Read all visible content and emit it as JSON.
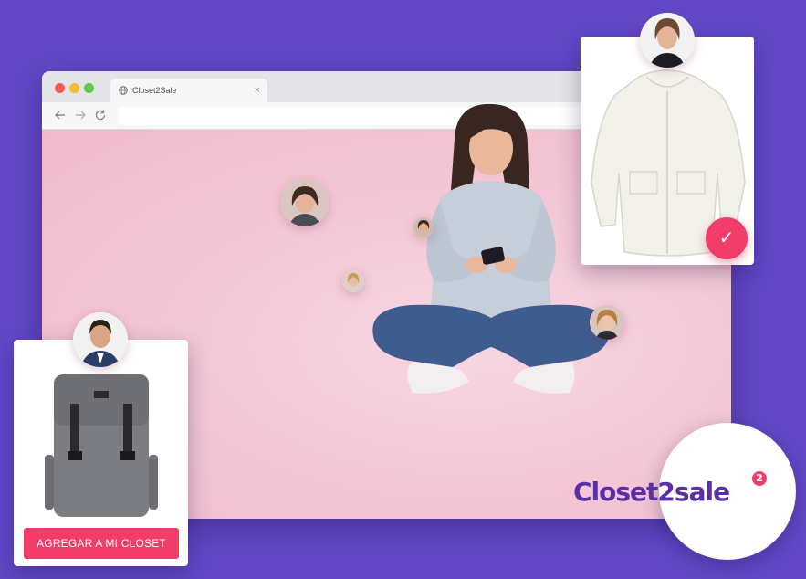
{
  "browser": {
    "tab_title": "Closet2Sale",
    "tab_close": "×",
    "url": ""
  },
  "icons": {
    "back": "back-arrow-icon",
    "forward": "forward-arrow-icon",
    "reload": "reload-icon",
    "globe": "globe-icon",
    "check": "checkmark-icon"
  },
  "cards": {
    "top_check_symbol": "✓",
    "left_button_label": "AGREGAR A MI CLOSET"
  },
  "logo": {
    "text": "Closet2sale",
    "badge": "2"
  },
  "colors": {
    "background": "#6248c6",
    "accent": "#f23d6b",
    "brand": "#5b2fa8"
  }
}
